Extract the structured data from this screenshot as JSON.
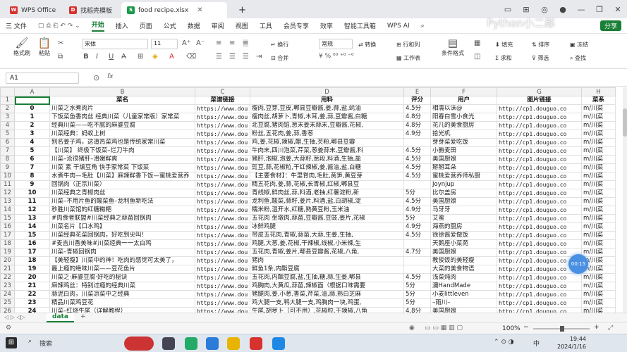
{
  "tabs": [
    {
      "label": "WPS Office",
      "icon_color": "#d7322e",
      "icon": "W"
    },
    {
      "label": "找稻壳模板",
      "icon_color": "#d7322e",
      "icon": "D"
    },
    {
      "label": "food recipe.xlsx",
      "icon_color": "#1a9a4b",
      "icon": "S"
    }
  ],
  "new_tab": "+",
  "menu": {
    "file": "三 文件",
    "items": [
      "开始",
      "插入",
      "页面",
      "公式",
      "数据",
      "审阅",
      "视图",
      "工具",
      "会员专享",
      "效率",
      "智能工具箱",
      "WPS AI"
    ],
    "active": "开始",
    "watermark": "Python小二郎",
    "share": "分享"
  },
  "ribbon": {
    "format_painter": "格式刷",
    "paste": "粘贴",
    "cut": "✂",
    "font_name": "宋体",
    "font_size": "11",
    "bold": "B",
    "italic": "I",
    "underline": "U",
    "wrap": "换行",
    "merge": "合并",
    "number_format": "常规",
    "convert": "转换",
    "row_col": "行和列",
    "worksheet": "工作表",
    "cond_format": "条件格式",
    "fill": "填充",
    "sort": "排序",
    "freeze": "冻结",
    "sum": "求和",
    "filter": "筛选",
    "find": "查找"
  },
  "formula_bar": {
    "cell_ref": "A1",
    "fx": "fx",
    "value": ""
  },
  "columns": [
    "",
    "A",
    "B",
    "C",
    "D",
    "E",
    "F",
    "G",
    "H"
  ],
  "header_row": {
    "row": "1",
    "cells": [
      "",
      "菜名",
      "菜谱链接",
      "用料",
      "评分",
      "用户",
      "图片链接",
      "菜系"
    ]
  },
  "rows": [
    {
      "r": "2",
      "a": "0",
      "b": "川菜之水煮肉片",
      "c": "https://www.dou",
      "d": "瘦肉,豆芽,豆皮,郫县豆瓣酱,姜,蒜,盐,蚝油",
      "e": "4.5分",
      "f": "相濡以沫@",
      "g": "http://cp1.douguo.co",
      "h": "m/川菜"
    },
    {
      "r": "3",
      "a": "1",
      "b": "下饭菜鱼香肉丝 经典川菜（儿童家常版）家常菜",
      "c": "https://www.dou",
      "d": "瘦肉丝,胡萝卜,青椒,木耳,姜,蒜,豆瓣酱,白糖",
      "e": "4.8分",
      "f": "阳春白雪小食光",
      "g": "http://cp1.douguo.co",
      "h": "m/川菜"
    },
    {
      "r": "4",
      "a": "2",
      "b": "经典川菜——吃不腻的麻婆豆腐",
      "c": "https://www.dou",
      "d": "北豆腐,猪肉馅,葱末姜末蒜末,豆瓣酱,花椒,",
      "e": "4.8分",
      "f": "花儿的美食厨房",
      "g": "http://cp1.douguo.co",
      "h": "m/川菜"
    },
    {
      "r": "5",
      "a": "3",
      "b": "川菜经典：蚂蚁上树",
      "c": "https://www.dou",
      "d": "粉丝,五花肉,姜,蒜,香葱",
      "e": "4.9分",
      "f": "拾光机",
      "g": "http://cp1.douguo.co",
      "h": "m/川菜"
    },
    {
      "r": "6",
      "a": "4",
      "b": "别名姜子鸡，这道热菜鸡也是传统家常川菜",
      "c": "https://www.dou",
      "d": "鸡,姜,花椒,辣椒,醋,生抽,芡粉,郫县豆瓣",
      "e": "",
      "f": "芽芽菜爱吃饭",
      "g": "http://cp1.douguo.co",
      "h": "m/川菜"
    },
    {
      "r": "7",
      "a": "5",
      "b": "【川菜】 终极下饭菜–烂刀牛肉",
      "c": "https://www.dou",
      "d": "牛肉末,四川泡菜,芹菜,葱姜蒜末,豆瓣酱,料",
      "e": "4.5分",
      "f": "小爵麦田",
      "g": "http://cp1.douguo.co",
      "h": "m/川菜"
    },
    {
      "r": "8",
      "a": "6",
      "b": "川菜–沧很猪肝–滑嫩鲜爽",
      "c": "https://www.dou",
      "d": "猪肝,泡椒,泡姜,大蒜籽,葱段,料酒,生抽,盐",
      "e": "4.5分",
      "f": "美国厨娘",
      "g": "http://cp1.douguo.co",
      "h": "m/川菜"
    },
    {
      "r": "9",
      "a": "7",
      "b": "川菜 素 干煸豆角 快手家常菜 下饭菜",
      "c": "https://www.dou",
      "d": "豇豆,蒜,花椒粒,干红辣椒,姜,酱油,盐,白糖",
      "e": "4.5分",
      "f": "掰掰耳朵",
      "g": "http://cp1.douguo.co",
      "h": "m/川菜"
    },
    {
      "r": "10",
      "a": "8",
      "b": "水煮牛肉—毛肚【川菜】麻辣鲜香下饭—蜜桃爱营养",
      "c": "https://www.dou",
      "d": "【主要食材】：牛里脊肉,毛肚,莴笋,黄豆芽",
      "e": "4.5分",
      "f": "蜜桃爱营养师私厨",
      "g": "http://cp1.douguo.co",
      "h": "m/川菜"
    },
    {
      "r": "11",
      "a": "9",
      "b": "回锅肉（正宗川菜）",
      "c": "https://www.dou",
      "d": "精五花肉,姜,蒜,花椒,长青椒,红椒,郫县豆",
      "e": "",
      "f": "Joynjup",
      "g": "http://cp1.douguo.co",
      "h": "m/川菜"
    },
    {
      "r": "12",
      "a": "10",
      "b": "川菜经典之青椒肉丝",
      "c": "https://www.dou",
      "d": "青线椒,鲜肉丝,蒜,料酒,老抽,红薯淀粉,新",
      "e": "5分",
      "f": "比尔盖房",
      "g": "http://cp1.douguo.co",
      "h": "m/川菜"
    },
    {
      "r": "13",
      "a": "11",
      "b": "川菜–不用片鱼的酸菜鱼–龙利鱼新吃法",
      "c": "https://www.dou",
      "d": "龙利鱼,酸菜,蒜籽,姜片,料酒,盐,白胡椒,淀",
      "e": "4.5分",
      "f": "美国厨娘",
      "g": "http://cp1.douguo.co",
      "h": "m/川菜"
    },
    {
      "r": "14",
      "a": "12",
      "b": "秒胜川菜馆的红糖糍粑",
      "c": "https://www.dou",
      "d": "糯米粉,温开水,红糖,熟黄豆粉,玉米油",
      "e": "4.9分",
      "f": "马牙牙",
      "g": "http://cp1.douguo.co",
      "h": "m/川菜"
    },
    {
      "r": "15",
      "a": "13",
      "b": "#肉食者联盟#川菜经典之蒜苗回锅肉",
      "c": "https://www.dou",
      "d": "五花肉 坐墩肉,蒜苗,豆瓣酱,豆豉,姜片,花椒",
      "e": "5分",
      "f": "艾蜜",
      "g": "http://cp1.douguo.co",
      "h": "m/川菜"
    },
    {
      "r": "16",
      "a": "14",
      "b": "川菜名片【口水鸡】",
      "c": "https://www.dou",
      "d": "冰鲜鸡腿",
      "e": "4.9分",
      "f": "海燕的厨房",
      "g": "http://cp1.douguo.co",
      "h": "m/川菜"
    },
    {
      "r": "17",
      "a": "15",
      "b": "川菜经典花菜回锅肉，好吃到尖叫！",
      "c": "https://www.dou",
      "d": "带皮五花肉,青椒,蒜苗,大蒜,生姜,生抽,",
      "e": "4.5分",
      "f": "徐徐酱爱做饭",
      "g": "http://cp1.douguo.co",
      "h": "m/川菜"
    },
    {
      "r": "18",
      "a": "16",
      "b": "#麦吉川香美味#川菜经典一一太白鸡",
      "c": "https://www.dou",
      "d": "鸡腿,大葱,姜,花椒,干辣椒,线椒,小米辣,生",
      "e": "",
      "f": "天鹅座小菜苑",
      "g": "http://cp1.douguo.co",
      "h": "m/川菜"
    },
    {
      "r": "19",
      "a": "17",
      "b": "川菜–青椒回锅肉",
      "c": "https://www.dou",
      "d": "五花肉,青椒,姜片,郫县豆瓣酱,花椒,八角,",
      "e": "4.7分",
      "f": "美国厨娘",
      "g": "http://cp1.douguo.co",
      "h": "m/川菜"
    },
    {
      "r": "20",
      "a": "18",
      "b": "【美轻瘦】川菜中的神！吃肉的感觉可太美了，",
      "c": "https://www.dou",
      "d": "猪肉",
      "e": "",
      "f": "教俊饭的美轻瘦",
      "g": "http://cp1.douguo.co",
      "h": "m/川菜"
    },
    {
      "r": "21",
      "a": "19",
      "b": "最上瘾的绝味川菜——豆花鱼片",
      "c": "https://www.dou",
      "d": "鲜鱼1条,内酯豆腐",
      "e": "",
      "f": "大菜的美食物语",
      "g": "http://cp1.douguo.co",
      "h": "m/川菜"
    },
    {
      "r": "22",
      "a": "20",
      "b": "川菜之·麻婆豆腐·好吃的秘诀",
      "c": "https://www.dou",
      "d": "五花肉,内酯豆腐,盐,生抽,糖,蒜,生姜,郫县",
      "e": "4.5分",
      "f": "浅菜炖肉",
      "g": "http://cp1.douguo.co",
      "h": "m/川菜"
    },
    {
      "r": "23",
      "a": "21",
      "b": "麻辣鸡丝：特别过瘾的经典川菜",
      "c": "https://www.dou",
      "d": "鸡胸肉,大黄瓜,蒜苗,辣椒面（根据口味需要",
      "e": "5分",
      "f": "瀰HandMade",
      "g": "http://cp1.douguo.co",
      "h": "m/川菜"
    },
    {
      "r": "24",
      "a": "22",
      "b": "蒜泥白肉，川菜凉菜中之经典",
      "c": "https://www.dou",
      "d": "猪腿肉,姜,小葱,香菜,芹菜,油,蒜,熟白芝麻",
      "e": "5分",
      "f": "小麦littleven",
      "g": "http://cp1.douguo.co",
      "h": "m/川菜"
    },
    {
      "r": "25",
      "a": "23",
      "b": "精品川菜鸡豆花",
      "c": "https://www.dou",
      "d": "鸡大腿一支,鸭大腿一支,鸡胸肉一块,鸡蛋,",
      "e": "5分",
      "f": "–雨川–",
      "g": "http://cp1.douguo.co",
      "h": "m/川菜"
    },
    {
      "r": "26",
      "a": "24",
      "b": "川菜–红烧牛尾（详解教程）",
      "c": "https://www.dou",
      "d": "牛尾,胡萝卜（可不用）,花椒粒,干辣椒,八角",
      "e": "4.8分",
      "f": "美国厨娘",
      "g": "http://cp1.douguo.co",
      "h": "m/川菜"
    }
  ],
  "sheet_tab": "data",
  "status": {
    "zoom": "100%",
    "minus": "−",
    "plus": "+"
  },
  "taskbar": {
    "search": "搜索",
    "time": "19:44",
    "date": "2024/1/16",
    "lang": "中",
    "bubble": "00:15"
  }
}
